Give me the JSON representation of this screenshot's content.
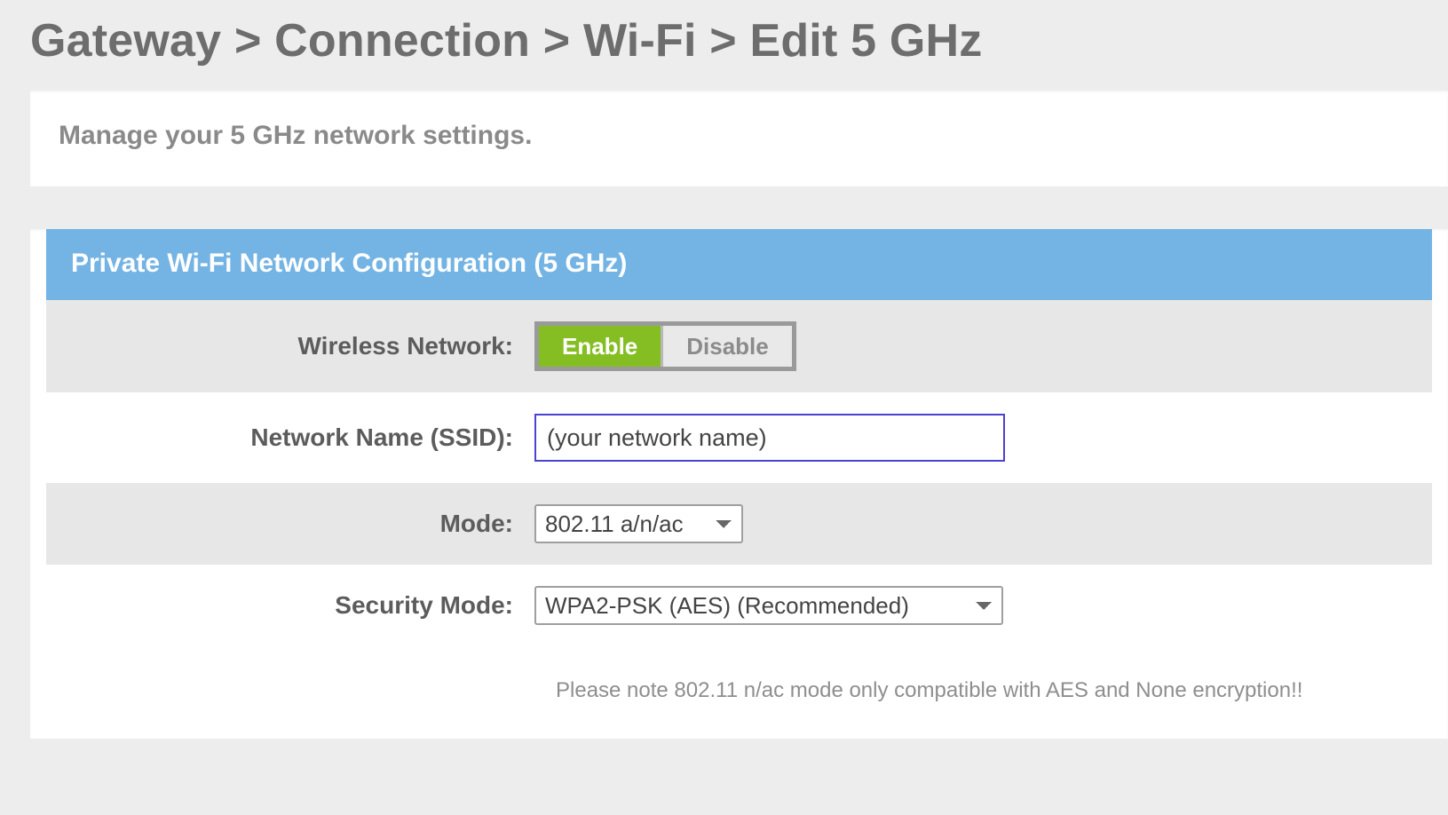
{
  "breadcrumb": "Gateway > Connection > Wi-Fi > Edit 5 GHz",
  "intro": "Manage your 5 GHz network settings.",
  "section_title": "Private Wi-Fi Network Configuration (5 GHz)",
  "fields": {
    "wireless_network": {
      "label": "Wireless Network:",
      "enable_label": "Enable",
      "disable_label": "Disable",
      "active": "enable"
    },
    "ssid": {
      "label": "Network Name (SSID):",
      "value": "(your network name)"
    },
    "mode": {
      "label": "Mode:",
      "selected": "802.11 a/n/ac"
    },
    "security_mode": {
      "label": "Security Mode:",
      "selected": "WPA2-PSK (AES) (Recommended)"
    }
  },
  "note": "Please note 802.11 n/ac mode only compatible with AES and None encryption!!"
}
